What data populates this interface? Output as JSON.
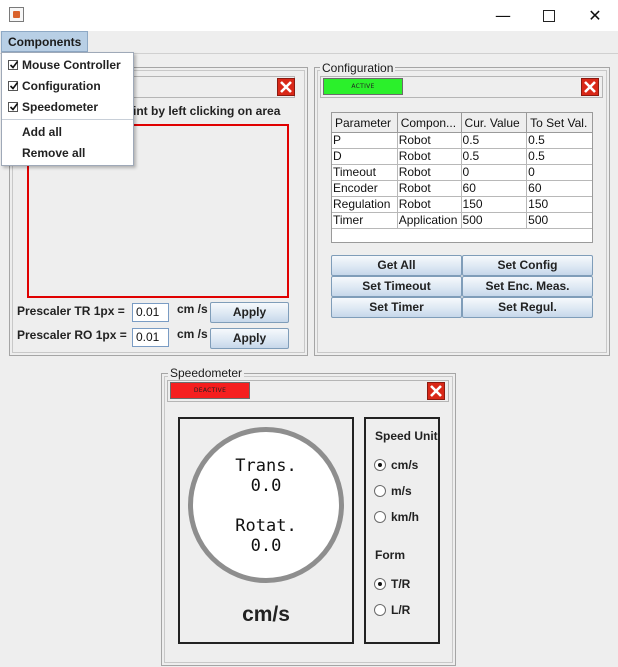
{
  "window": {
    "minimize": "—",
    "close": "✕"
  },
  "menubar": {
    "components_label": "Components"
  },
  "components_menu": {
    "items": [
      {
        "label": "Mouse Controller",
        "checked": true
      },
      {
        "label": "Configuration",
        "checked": true
      },
      {
        "label": "Speedometer",
        "checked": true
      }
    ],
    "add_all": "Add all",
    "remove_all": "Remove all"
  },
  "mouse_controller": {
    "instruction_partial": "int by left clicking on area",
    "prescaler_tr_label": "Prescaler TR 1px =",
    "prescaler_tr_value": "0.01",
    "prescaler_tr_unit": "cm /s",
    "prescaler_ro_label": "Prescaler RO 1px =",
    "prescaler_ro_value": "0.01",
    "prescaler_ro_unit": "cm /s",
    "apply_label": "Apply"
  },
  "configuration": {
    "title": "Configuration",
    "status": "ACTIVE",
    "columns": [
      "Parameter",
      "Compon...",
      "Cur. Value",
      "To Set Val."
    ],
    "rows": [
      [
        "P",
        "Robot",
        "0.5",
        "0.5"
      ],
      [
        "D",
        "Robot",
        "0.5",
        "0.5"
      ],
      [
        "Timeout",
        "Robot",
        "0",
        "0"
      ],
      [
        "Encoder",
        "Robot",
        "60",
        "60"
      ],
      [
        "Regulation",
        "Robot",
        "150",
        "150"
      ],
      [
        "Timer",
        "Application",
        "500",
        "500"
      ]
    ],
    "buttons": {
      "get_all": "Get All",
      "set_config": "Set Config",
      "set_timeout": "Set Timeout",
      "set_enc_meas": "Set Enc. Meas.",
      "set_timer": "Set Timer",
      "set_regul": "Set Regul."
    }
  },
  "speedometer": {
    "title": "Speedometer",
    "status": "DEACTIVE",
    "trans_label": "Trans.",
    "trans_value": "0.0",
    "rotat_label": "Rotat.",
    "rotat_value": "0.0",
    "unit_display": "cm/s",
    "speed_unit_heading": "Speed Unit",
    "units": [
      {
        "label": "cm/s",
        "selected": true
      },
      {
        "label": "m/s",
        "selected": false
      },
      {
        "label": "km/h",
        "selected": false
      }
    ],
    "form_heading": "Form",
    "forms": [
      {
        "label": "T/R",
        "selected": true
      },
      {
        "label": "L/R",
        "selected": false
      }
    ]
  },
  "colors": {
    "active": "#2bf02b",
    "deactive": "#f51f1f",
    "close_red": "#d92818",
    "canvas_border": "#e00000"
  }
}
